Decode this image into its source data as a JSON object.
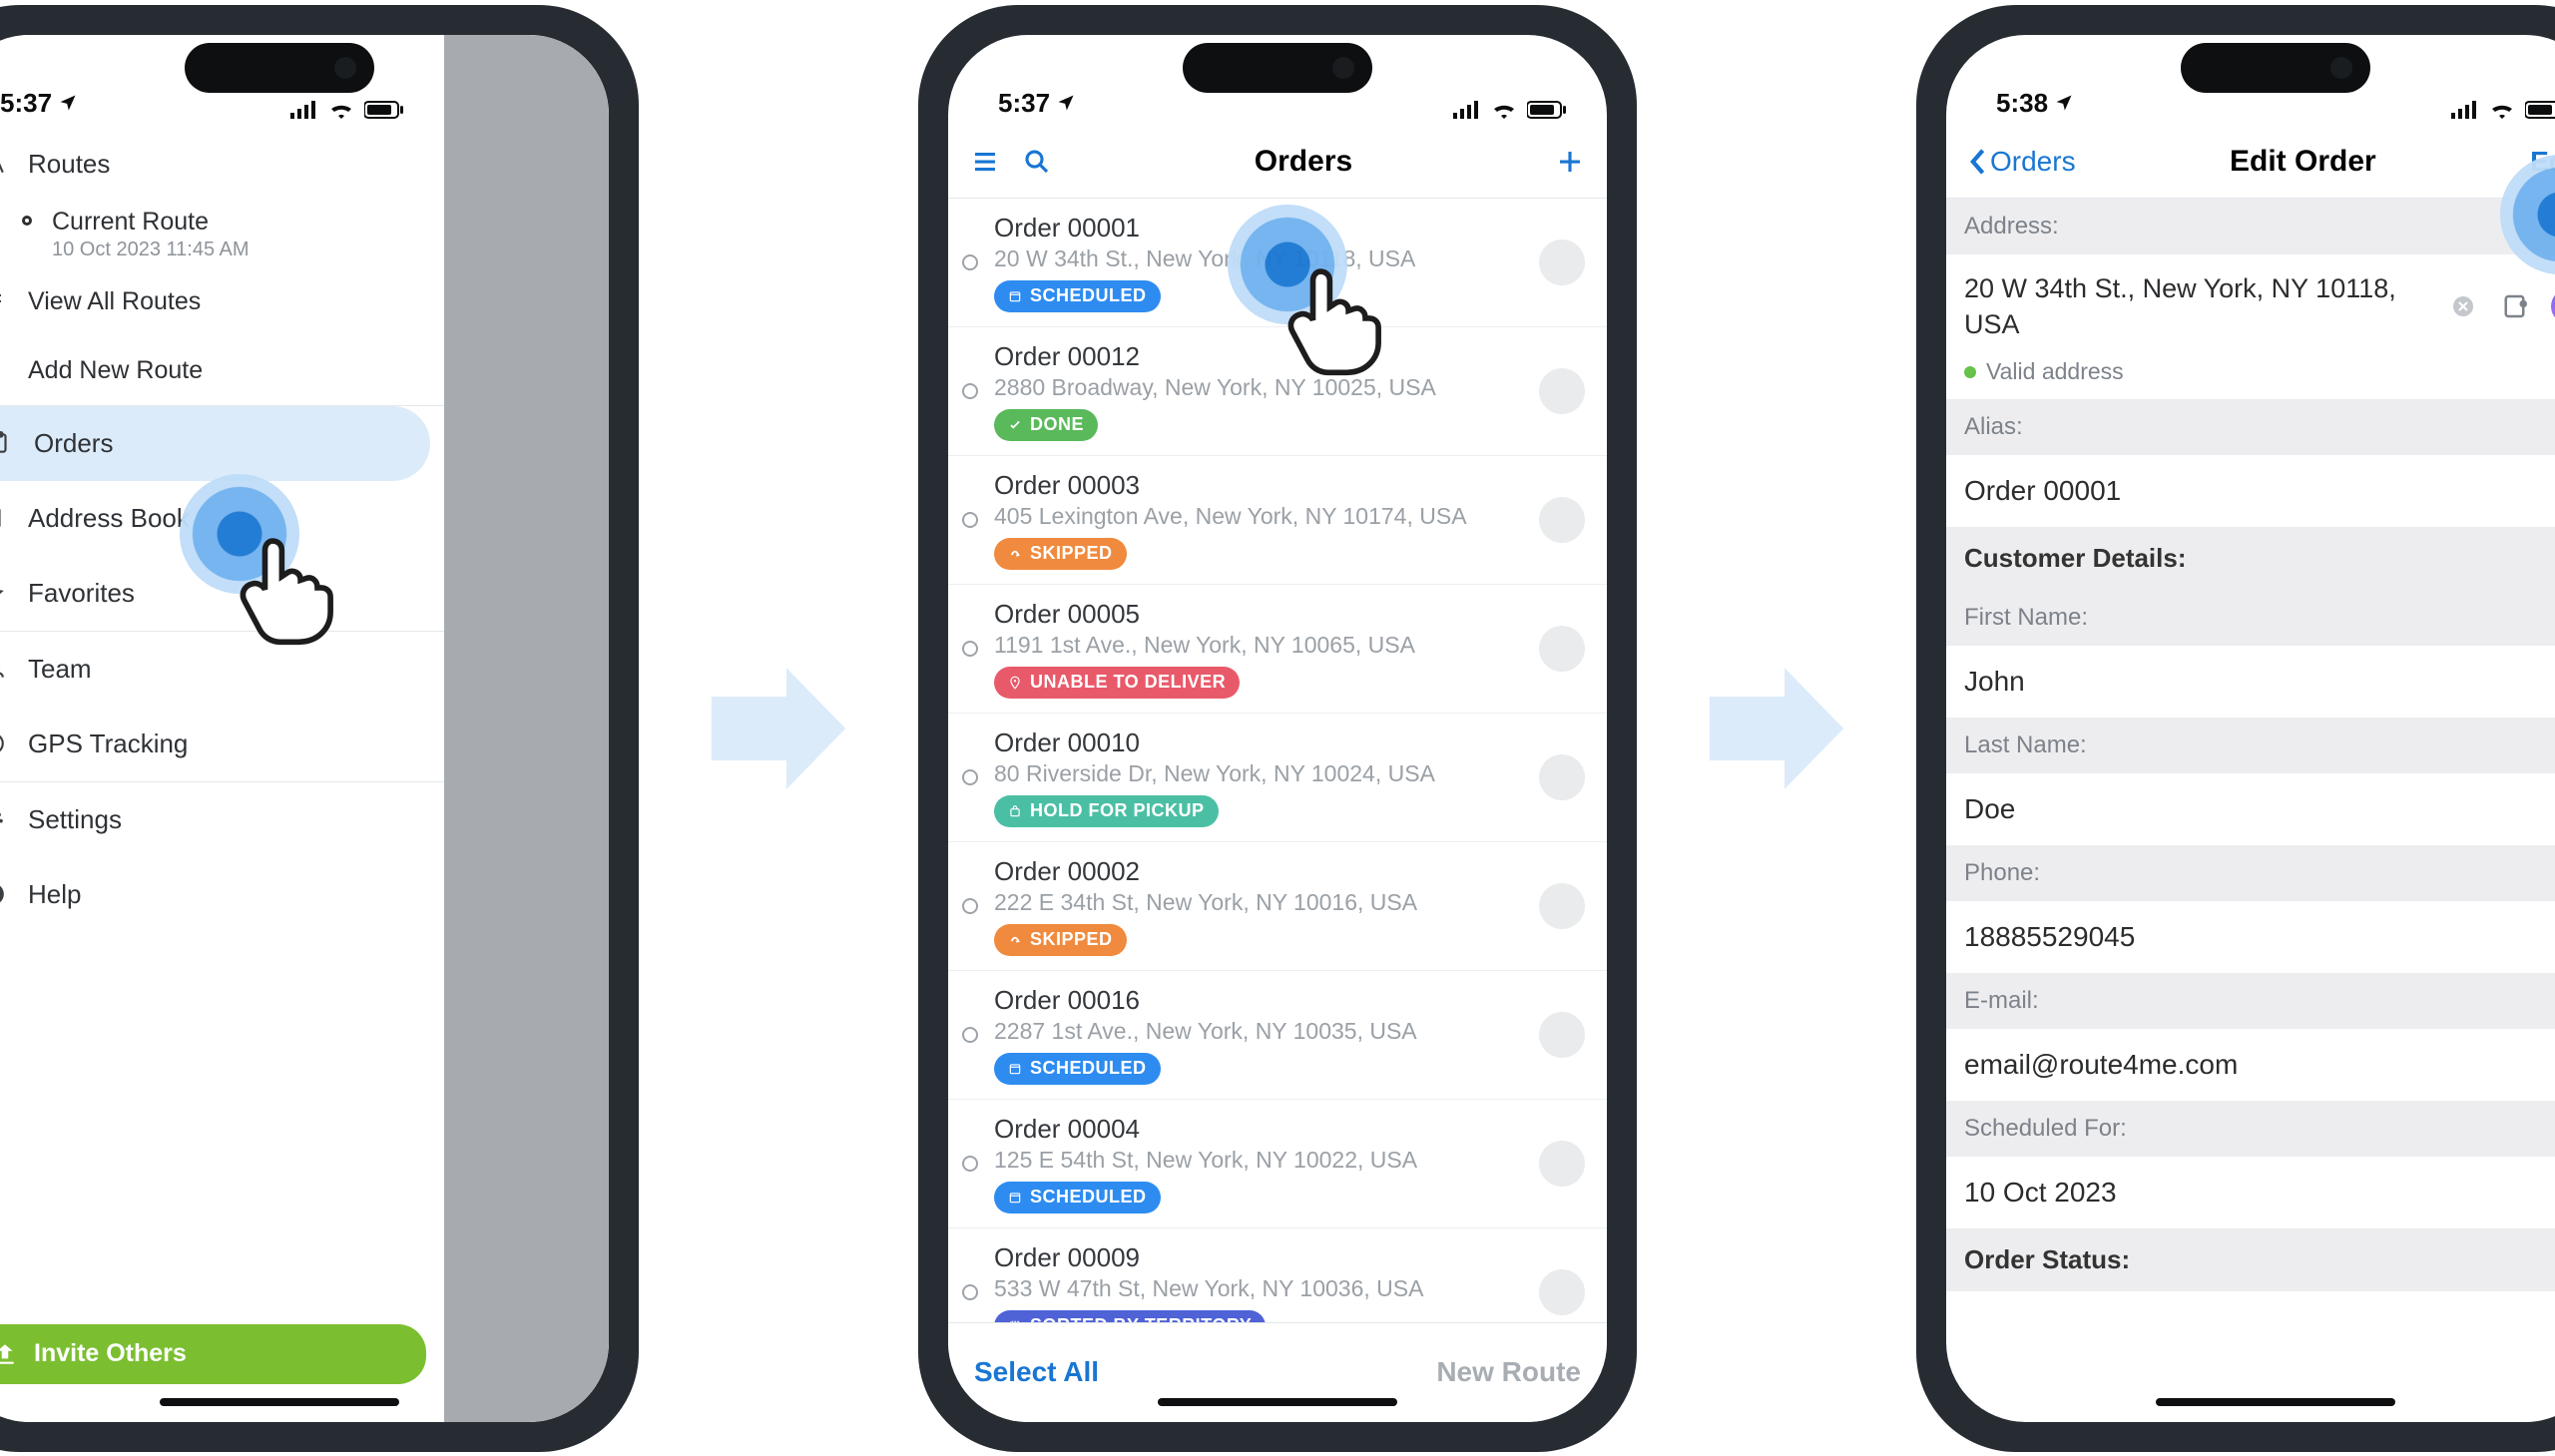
{
  "phone1": {
    "time": "5:37",
    "nav": {
      "routes": "Routes",
      "current_route": "Current Route",
      "current_route_sub": "10 Oct 2023  11:45 AM",
      "view_all": "View All Routes",
      "add_new": "Add New Route",
      "orders": "Orders",
      "address_book": "Address Book",
      "favorites": "Favorites",
      "team": "Team",
      "gps": "GPS Tracking",
      "settings": "Settings",
      "help": "Help",
      "invite": "Invite Others"
    }
  },
  "phone2": {
    "time": "5:37",
    "title": "Orders",
    "select_all": "Select All",
    "new_route": "New Route",
    "status": {
      "scheduled": "SCHEDULED",
      "done": "DONE",
      "skipped": "SKIPPED",
      "unable": "UNABLE TO DELIVER",
      "hold": "HOLD FOR PICKUP",
      "sorted": "SORTED BY TERRITORY"
    },
    "orders": [
      {
        "name": "Order 00001",
        "addr": "20 W 34th St., New York, NY 10118, USA",
        "status": "scheduled"
      },
      {
        "name": "Order 00012",
        "addr": "2880 Broadway, New York, NY 10025, USA",
        "status": "done"
      },
      {
        "name": "Order 00003",
        "addr": "405 Lexington Ave, New York, NY 10174, USA",
        "status": "skipped"
      },
      {
        "name": "Order 00005",
        "addr": "1191 1st Ave., New York, NY 10065, USA",
        "status": "unable"
      },
      {
        "name": "Order 00010",
        "addr": "80 Riverside Dr, New York, NY 10024, USA",
        "status": "hold"
      },
      {
        "name": "Order 00002",
        "addr": "222 E 34th St, New York, NY 10016, USA",
        "status": "skipped"
      },
      {
        "name": "Order 00016",
        "addr": "2287 1st Ave., New York, NY 10035, USA",
        "status": "scheduled"
      },
      {
        "name": "Order 00004",
        "addr": "125 E 54th St, New York, NY 10022, USA",
        "status": "scheduled"
      },
      {
        "name": "Order 00009",
        "addr": "533 W 47th St, New York, NY 10036, USA",
        "status": "sorted"
      }
    ]
  },
  "phone3": {
    "time": "5:38",
    "back": "Orders",
    "title": "Edit Order",
    "edit": "Edit",
    "labels": {
      "address": "Address:",
      "valid": "Valid address",
      "alias": "Alias:",
      "customer_details": "Customer Details:",
      "first_name": "First Name:",
      "last_name": "Last Name:",
      "phone": "Phone:",
      "email": "E-mail:",
      "scheduled_for": "Scheduled For:",
      "order_status": "Order Status:"
    },
    "values": {
      "address": "20 W 34th St., New York, NY 10118, USA",
      "alias": "Order 00001",
      "first_name": "John",
      "last_name": "Doe",
      "phone": "18885529045",
      "email": "email@route4me.com",
      "scheduled_for": "10 Oct 2023"
    }
  }
}
